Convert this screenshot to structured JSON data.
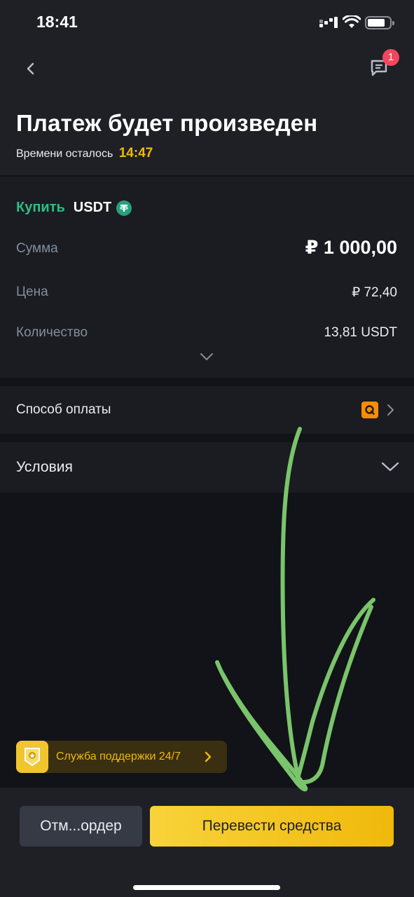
{
  "status_bar": {
    "time": "18:41"
  },
  "header": {
    "title": "Платеж будет произведен",
    "timer_label": "Времени осталось",
    "timer_value": "14:47",
    "chat_badge_count": "1"
  },
  "order": {
    "action_label": "Купить",
    "asset": "USDT",
    "rows": [
      {
        "label": "Сумма",
        "value": "₽ 1 000,00"
      },
      {
        "label": "Цена",
        "value": "₽ 72,40"
      },
      {
        "label": "Количество",
        "value": "13,81 USDT"
      }
    ]
  },
  "payment": {
    "label": "Способ оплаты",
    "method_icon": "qiwi-icon"
  },
  "terms": {
    "label": "Условия"
  },
  "support": {
    "label": "Служба поддержки 24/7"
  },
  "actions": {
    "cancel_label": "Отм...ордер",
    "transfer_label": "Перевести средства"
  },
  "colors": {
    "accent_yellow": "#f0b90b",
    "buy_green": "#2ebd85",
    "badge_red": "#f6465d",
    "annotation_green": "#7ac46b"
  }
}
